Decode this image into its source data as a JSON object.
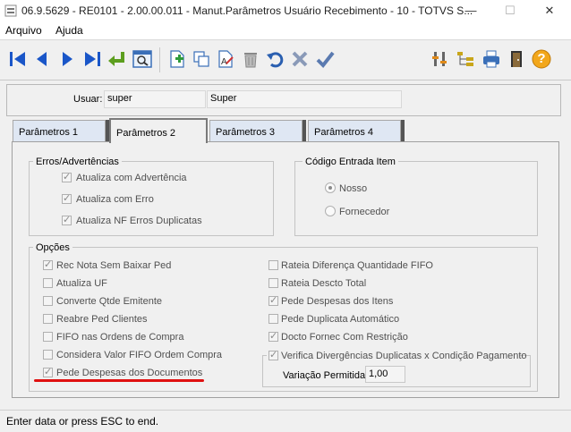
{
  "window": {
    "title": "06.9.5629 - RE0101 - 2.00.00.011 - Manut.Parâmetros Usuário Recebimento - 10 - TOTVS S...",
    "controls": [
      "—",
      "☐",
      "✕"
    ]
  },
  "menu": {
    "items": [
      "Arquivo",
      "Ajuda"
    ]
  },
  "toolbar": {
    "icons": [
      "first-icon",
      "prev-icon",
      "next-icon",
      "last-icon",
      "goto-icon",
      "search-icon",
      "new-icon",
      "copy-icon",
      "edit-icon",
      "delete-icon",
      "undo-icon",
      "cancel-icon",
      "save-icon",
      "tools-icon",
      "tree-icon",
      "print-icon",
      "exit-icon",
      "help-icon"
    ],
    "help_label": "?"
  },
  "header": {
    "usuar_label": "Usuar:",
    "usuar_code": "super",
    "usuar_name": "Super"
  },
  "tabs": [
    {
      "label": "Parâmetros 1",
      "active": false
    },
    {
      "label": "Parâmetros 2",
      "active": true
    },
    {
      "label": "Parâmetros 3",
      "active": false
    },
    {
      "label": "Parâmetros 4",
      "active": false
    }
  ],
  "erros": {
    "title": "Erros/Advertências",
    "items": [
      {
        "label": "Atualiza com Advertência",
        "checked": true
      },
      {
        "label": "Atualiza com Erro",
        "checked": true
      },
      {
        "label": "Atualiza NF Erros Duplicatas",
        "checked": true
      }
    ]
  },
  "codigo": {
    "title": "Código Entrada Item",
    "options": [
      {
        "label": "Nosso",
        "selected": true
      },
      {
        "label": "Fornecedor",
        "selected": false
      }
    ]
  },
  "opcoes": {
    "title": "Opções",
    "left": [
      {
        "label": "Rec Nota Sem Baixar Ped",
        "checked": true
      },
      {
        "label": "Atualiza UF",
        "checked": false
      },
      {
        "label": "Converte Qtde Emitente",
        "checked": false
      },
      {
        "label": "Reabre Ped Clientes",
        "checked": false
      },
      {
        "label": "FIFO nas Ordens de Compra",
        "checked": false
      },
      {
        "label": "Considera Valor FIFO Ordem Compra",
        "checked": false
      },
      {
        "label": "Pede Despesas dos Documentos",
        "checked": true
      }
    ],
    "right": [
      {
        "label": "Rateia Diferença Quantidade FIFO",
        "checked": false
      },
      {
        "label": "Rateia Descto Total",
        "checked": false
      },
      {
        "label": "Pede Despesas dos Itens",
        "checked": true
      },
      {
        "label": "Pede Duplicata Automático",
        "checked": false
      },
      {
        "label": "Docto Fornec Com Restrição",
        "checked": true
      }
    ],
    "verifica": {
      "label": "Verifica Divergências Duplicatas x Condição Pagamento",
      "checked": true,
      "variacao_label": "Variação Permitida:",
      "variacao_value": "1,00"
    }
  },
  "status": {
    "text": "Enter data or press ESC to end."
  },
  "colors": {
    "accent_blue": "#1a56c8",
    "annotation_red": "#e01010"
  }
}
